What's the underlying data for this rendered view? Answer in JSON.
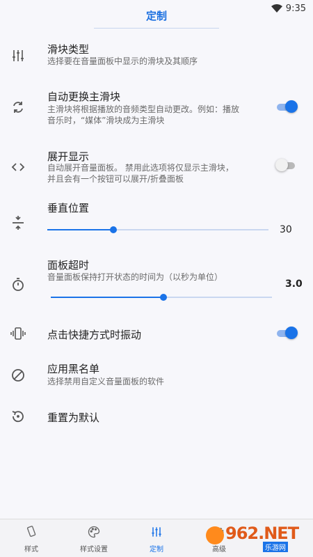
{
  "status_bar": {
    "time": "9:35"
  },
  "header": {
    "title": "定制"
  },
  "settings": {
    "slider_type": {
      "title": "滑块类型",
      "subtitle": "选择要在音量面板中显示的滑块及其顺序"
    },
    "auto_switch": {
      "title": "自动更换主滑块",
      "subtitle_line1": "主滑块将根据播放的音频类型自动更改。例如：播放",
      "subtitle_line2": "音乐时，“媒体”滑块成为主滑块",
      "enabled": true
    },
    "expand_display": {
      "title": "展开显示",
      "subtitle_line1": "自动展开音量面板。 禁用此选项将仅显示主滑块，",
      "subtitle_line2": "并且会有一个按钮可以展开/折叠面板",
      "enabled": false
    },
    "vertical_position": {
      "title": "垂直位置",
      "value": "30",
      "fraction": 0.3
    },
    "panel_timeout": {
      "title": "面板超时",
      "subtitle": "音量面板保持打开状态的时间为（以秒为单位）",
      "value": "3.0",
      "fraction": 0.51
    },
    "vibrate": {
      "title": "点击快捷方式时振动",
      "enabled": true
    },
    "blacklist": {
      "title": "应用黑名单",
      "subtitle": "选择禁用自定义音量面板的软件"
    },
    "reset": {
      "title": "重置为默认"
    }
  },
  "bottom_nav": {
    "items": [
      {
        "label": "样式",
        "icon": "phone-rotate-icon"
      },
      {
        "label": "样式设置",
        "icon": "palette-icon"
      },
      {
        "label": "定制",
        "icon": "tune-icon",
        "active": true
      },
      {
        "label": "高级",
        "icon": "gear-icon"
      }
    ]
  },
  "watermark": {
    "text": "962.NET",
    "sub": "乐游网"
  },
  "colors": {
    "accent": "#1a73e8",
    "background": "#f7f7fb"
  }
}
